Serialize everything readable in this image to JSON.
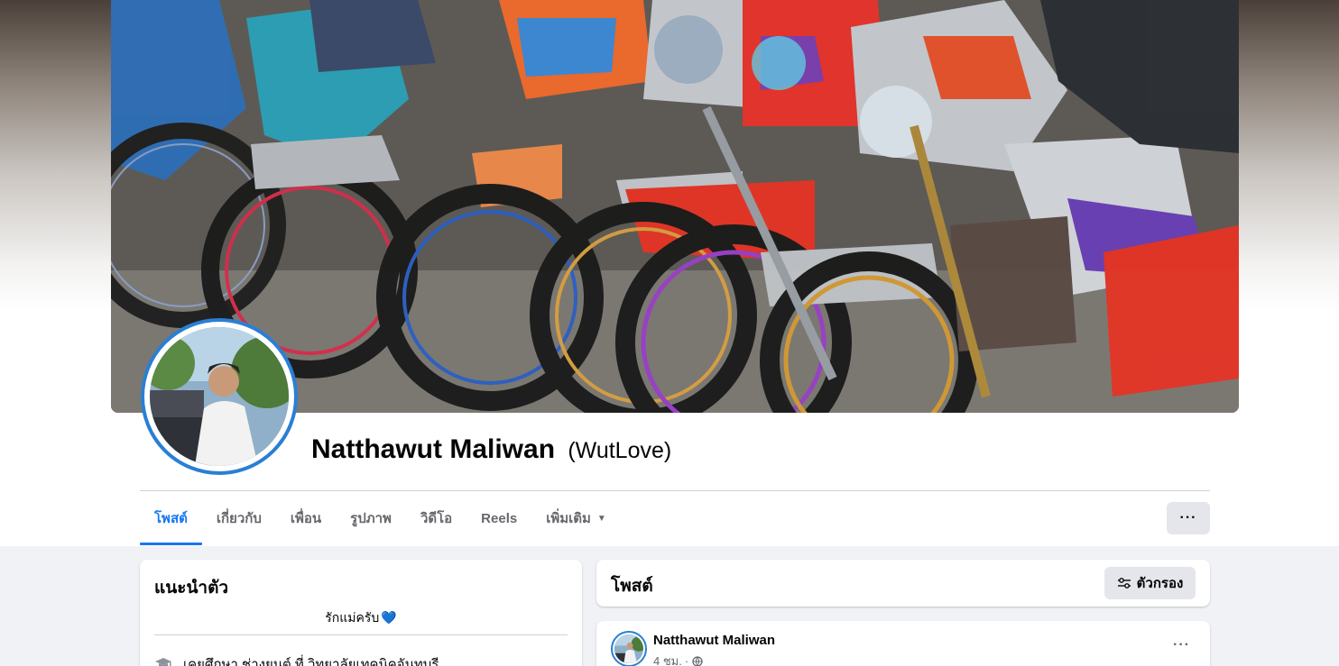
{
  "profile": {
    "name": "Natthawut Maliwan",
    "alternate_name": "(WutLove)"
  },
  "tabs": [
    {
      "label": "โพสต์",
      "active": true
    },
    {
      "label": "เกี่ยวกับ",
      "active": false
    },
    {
      "label": "เพื่อน",
      "active": false
    },
    {
      "label": "รูปภาพ",
      "active": false
    },
    {
      "label": "วิดีโอ",
      "active": false
    },
    {
      "label": "Reels",
      "active": false
    },
    {
      "label": "เพิ่มเติม",
      "active": false
    }
  ],
  "more_button_label": "···",
  "intro": {
    "title": "แนะนำตัว",
    "bio": "รักแม่ครับ",
    "bio_emoji": "💙",
    "education": "เคยศึกษา ช่างยนต์ ที่ วิทยาลัยเทคนิคจันทบุรี"
  },
  "posts": {
    "title": "โพสต์",
    "filter_label": "ตัวกรอง",
    "items": [
      {
        "author": "Natthawut Maliwan",
        "time": "4 ชม.",
        "separator": "·"
      }
    ]
  },
  "colors": {
    "accent": "#1877f2",
    "avatar_ring": "#2a7fd4",
    "background": "#f0f2f5",
    "button_gray": "#e4e6eb"
  },
  "icons": {
    "tab_more_caret": "chevron-down-icon",
    "education": "graduation-cap-icon",
    "filter": "sliders-icon",
    "privacy": "globe-icon"
  }
}
